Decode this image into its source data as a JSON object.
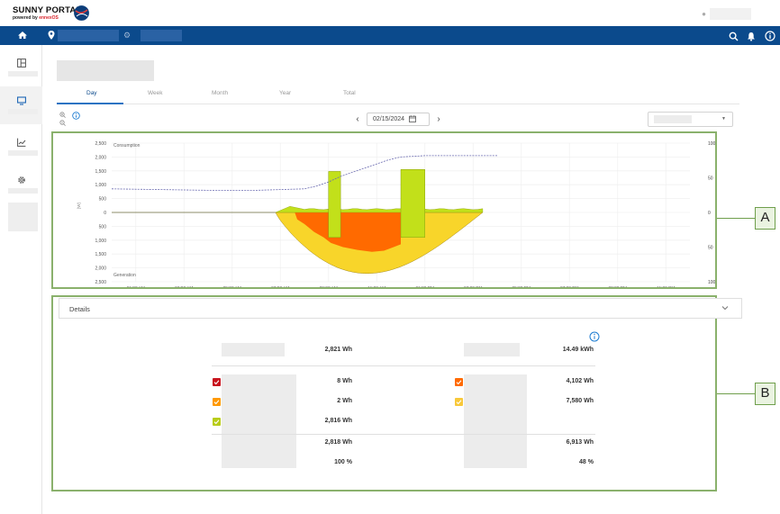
{
  "brand": {
    "name": "SUNNY PORTAL",
    "sub_prefix": "powered by ",
    "sub_brand": "ennexOS"
  },
  "tabs": [
    "Day",
    "Week",
    "Month",
    "Year",
    "Total"
  ],
  "date": {
    "value": "02/15/2024"
  },
  "chart_data": {
    "type": "area",
    "x_ticks": [
      "01:00 AM",
      "03:00 AM",
      "05:00 AM",
      "07:00 AM",
      "09:00 AM",
      "11:00 AM",
      "01:00 PM",
      "03:00 PM",
      "05:00 PM",
      "07:00 PM",
      "09:00 PM",
      "11:00 PM"
    ],
    "y_left_ticks": [
      "2,500",
      "2,000",
      "1,500",
      "1,000",
      "500",
      "0",
      "500",
      "1,000",
      "1,500",
      "2,000",
      "2,500"
    ],
    "y_left_unit": "[W]",
    "y_right_ticks": [
      "100",
      "50",
      "0",
      "50",
      "100"
    ],
    "y_right_unit": "[%]",
    "label_top": "Consumption",
    "label_bottom": "Generation",
    "ylim": [
      -2500,
      2500
    ],
    "colors": {
      "red": "#c8141e",
      "orange": "#ff6a00",
      "yellow": "#f8d52a",
      "lime": "#c2e01a",
      "soc": "#6a6ab0"
    },
    "series": [
      {
        "name": "",
        "description": "battery state of charge (dashed)",
        "x": [
          0,
          2,
          4,
          6,
          8,
          8.5,
          9,
          9.5,
          10,
          10.5,
          11,
          11.5,
          12,
          13,
          14,
          16
        ],
        "values": [
          34,
          33,
          32,
          32,
          34,
          38,
          44,
          52,
          58,
          64,
          70,
          76,
          80,
          82,
          82,
          82
        ]
      },
      {
        "name": "",
        "description": "lime load spike 1",
        "x": [
          9.0,
          9.25,
          9.5
        ],
        "values": [
          1450,
          1480,
          1460
        ]
      },
      {
        "name": "",
        "description": "lime load spike 2",
        "x": [
          12.0,
          12.5,
          13.0
        ],
        "values": [
          1500,
          1550,
          1500
        ]
      }
    ]
  },
  "details": {
    "title": "Details",
    "left_total": "2,821 Wh",
    "right_total": "14.49 kWh",
    "left_items": [
      {
        "color": "#c8141e",
        "value": "8 Wh"
      },
      {
        "color": "#ff9900",
        "value": "2 Wh"
      },
      {
        "color": "#b8cc1a",
        "value": "2,816 Wh"
      }
    ],
    "right_items": [
      {
        "color": "#ff6a00",
        "value": "4,102 Wh"
      },
      {
        "color": "#f8c83a",
        "value": "7,580 Wh"
      }
    ],
    "left_sum": "2,818 Wh",
    "right_sum": "6,913 Wh",
    "left_pct": "100 %",
    "right_pct": "48 %"
  },
  "callouts": {
    "a": "A",
    "b": "B"
  }
}
